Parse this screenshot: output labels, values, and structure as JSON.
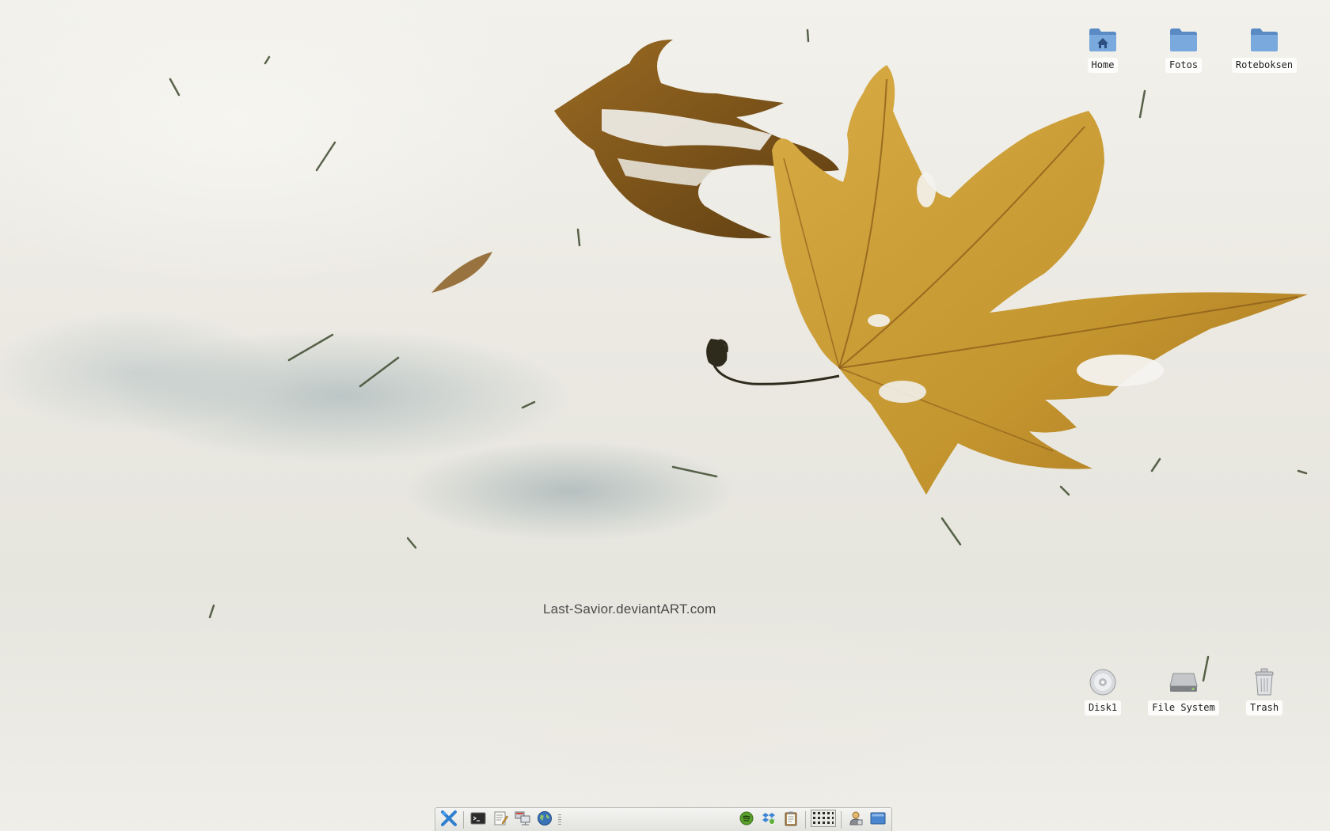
{
  "desktop": {
    "watermark": "Last-Savior.deviantART.com",
    "icons_top": [
      {
        "label": "Home",
        "icon": "home-folder-icon"
      },
      {
        "label": "Fotos",
        "icon": "folder-icon"
      },
      {
        "label": "Roteboksen",
        "icon": "folder-icon"
      }
    ],
    "icons_bottom": [
      {
        "label": "Disk1",
        "icon": "optical-disc-icon"
      },
      {
        "label": "File System",
        "icon": "hard-drive-icon"
      },
      {
        "label": "Trash",
        "icon": "trash-icon"
      }
    ]
  },
  "panel": {
    "launchers": [
      {
        "icon": "xfce-menu-icon"
      },
      {
        "icon": "terminal-icon"
      },
      {
        "icon": "text-editor-icon"
      },
      {
        "icon": "network-icon"
      },
      {
        "icon": "web-browser-icon"
      }
    ],
    "tray": [
      {
        "icon": "spotify-icon"
      },
      {
        "icon": "dropbox-icon"
      },
      {
        "icon": "clipboard-icon"
      },
      {
        "icon": "workspace-switcher-icon"
      },
      {
        "icon": "user-icon"
      },
      {
        "icon": "show-desktop-icon"
      }
    ]
  },
  "colors": {
    "snow": "#efeee8",
    "leaf_gold": "#c99a35",
    "leaf_brown": "#7a5518",
    "folder_blue": "#6f9fd4"
  }
}
